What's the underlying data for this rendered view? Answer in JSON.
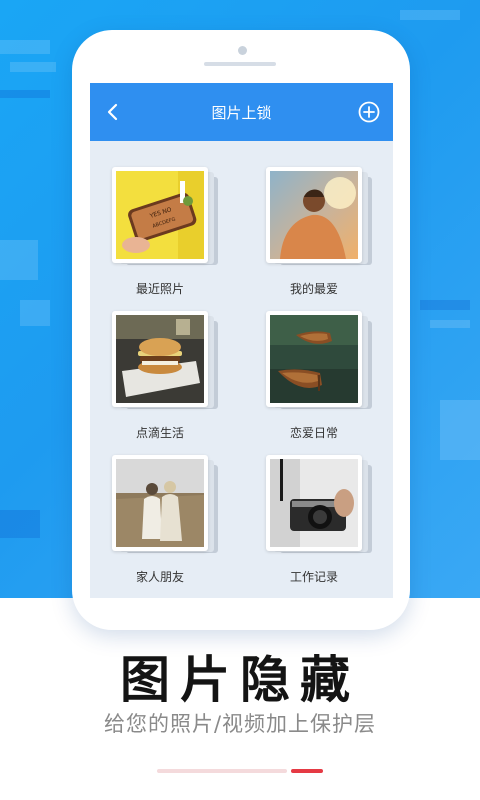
{
  "header": {
    "title": "图片上锁",
    "back_icon": "chevron-left-icon",
    "add_icon": "plus-circle-icon"
  },
  "albums": [
    {
      "label": "最近照片",
      "thumb": "ouija-board-photo"
    },
    {
      "label": "我的最爱",
      "thumb": "sunset-person-photo"
    },
    {
      "label": "点滴生活",
      "thumb": "burger-plate-photo"
    },
    {
      "label": "恋爱日常",
      "thumb": "rowboats-lake-photo"
    },
    {
      "label": "家人朋友",
      "thumb": "field-friends-photo"
    },
    {
      "label": "工作记录",
      "thumb": "camera-hands-photo"
    }
  ],
  "caption": {
    "title": "图片隐藏",
    "subtitle": "给您的照片/视频加上保护层"
  },
  "pager": {
    "total": 2,
    "active": 2
  },
  "colors": {
    "backdrop": "#1e9bf0",
    "header": "#2f8ff0",
    "screen_bg": "#e6edf5",
    "indicator_active": "#e53a44",
    "indicator_track": "#f4dadc",
    "title_text": "#141414",
    "subtitle_text": "#8a8a8a"
  }
}
